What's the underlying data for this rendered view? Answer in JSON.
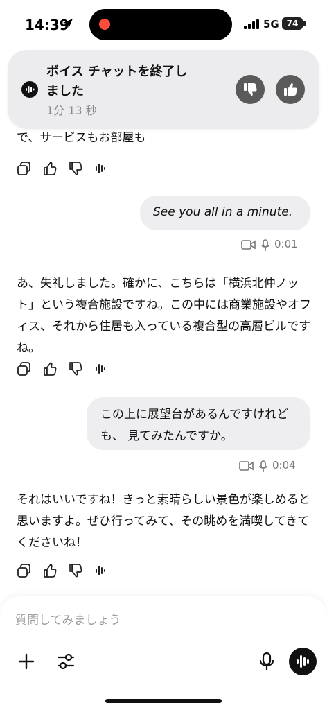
{
  "status_bar": {
    "time": "14:39",
    "network": "5G",
    "battery": "74"
  },
  "banner": {
    "title": "ボイス チャットを終了しました",
    "subtitle": "1分 13 秒",
    "icons": [
      "waveform-icon",
      "thumbs-down-icon",
      "thumbs-up-icon"
    ]
  },
  "messages": [
    {
      "role": "assistant",
      "text": "で、サービスもお部屋も"
    },
    {
      "role": "user",
      "text": "See you all in a minute.",
      "duration": "0:01"
    },
    {
      "role": "assistant",
      "text": "あ、失礼しました。確かに、こちらは「横浜北仲ノット」という複合施設ですね。この中には商業施設やオフィス、それから住居も入っている複合型の高層ビルですね。"
    },
    {
      "role": "user",
      "text": "この上に展望台があるんですけれども、 見てみたんですか。",
      "duration": "0:04"
    },
    {
      "role": "assistant",
      "text": "それはいいですね！きっと素晴らしい景色が楽しめると思いますよ。ぜひ行ってみて、その眺めを満喫してきてくださいね！"
    }
  ],
  "composer": {
    "placeholder": "質問してみましょう"
  },
  "icons": [
    "copy-icon",
    "thumbs-up-icon",
    "thumbs-down-icon",
    "voice-read-icon",
    "video-icon",
    "mic-icon",
    "plus-icon",
    "sliders-icon",
    "voice-mode-icon"
  ]
}
